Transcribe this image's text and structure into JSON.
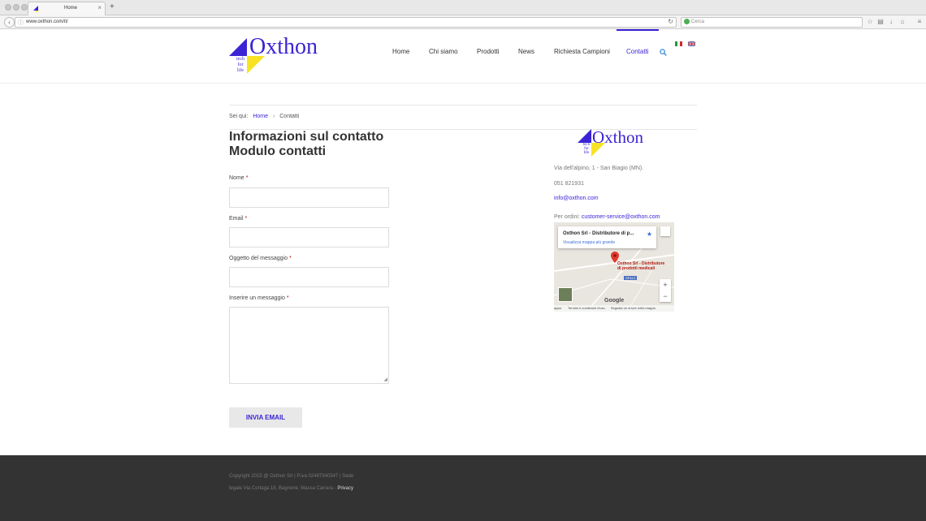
{
  "browser": {
    "tab_title": "Home",
    "tab_close": "×",
    "new_tab": "+",
    "url": "www.oxthon.com/it/",
    "search_placeholder": "Cerca"
  },
  "brand": {
    "name": "Oxthon",
    "tag_1": "tech",
    "tag_2": "for",
    "tag_3": "life",
    "blue": "#3b24d6",
    "yellow": "#f7e224"
  },
  "nav": {
    "items": [
      {
        "label": "Home"
      },
      {
        "label": "Chi siamo"
      },
      {
        "label": "Prodotti"
      },
      {
        "label": "News"
      },
      {
        "label": "Richiesta Campioni"
      },
      {
        "label": "Contatti",
        "active": true
      }
    ],
    "icons": [
      "search-icon",
      "flag-it-icon",
      "flag-uk-icon"
    ]
  },
  "breadcrumb": {
    "prefix": "Sei qui:",
    "home": "Home",
    "separator": "›",
    "current": "Contatti"
  },
  "page": {
    "title_line1": "Informazioni sul contatto",
    "title_line2": "Modulo contatti"
  },
  "form": {
    "required_mark": "*",
    "name_label": "Nome",
    "name_value": "",
    "email_label": "Email",
    "email_value": "",
    "subject_label": "Oggetto del messaggio",
    "subject_value": "",
    "message_label": "Inserire un messaggio",
    "message_value": "",
    "submit_label": "INVIA EMAIL"
  },
  "contact": {
    "address": "Via dell'alpino, 1 - San Biagio (MN).",
    "phone": "051 821931",
    "email": "info@oxthon.com",
    "orders_prefix": "Per ordini:",
    "orders_email": "customer-service@oxthon.com"
  },
  "map": {
    "card_title": "Oxthon Srl - Distributore di p...",
    "card_link": "Visualizza mappa più grande",
    "place_label": "Oxthon Srl - Distributore di prodotti medicali",
    "road_label": "SP413",
    "zoom_in": "+",
    "zoom_out": "−",
    "google": "Google",
    "footer_left": "appa",
    "footer_terms": "Termini e condizioni d'uso",
    "footer_report": "Segnala un errore nella mappa"
  },
  "footer": {
    "copyright": "Copyright 2015 @ Oxthon Srl | P.iva 02487340347 | Sede legale Via Cortaga 18, Bagnone, Massa Carrara -",
    "privacy": "Privacy"
  }
}
